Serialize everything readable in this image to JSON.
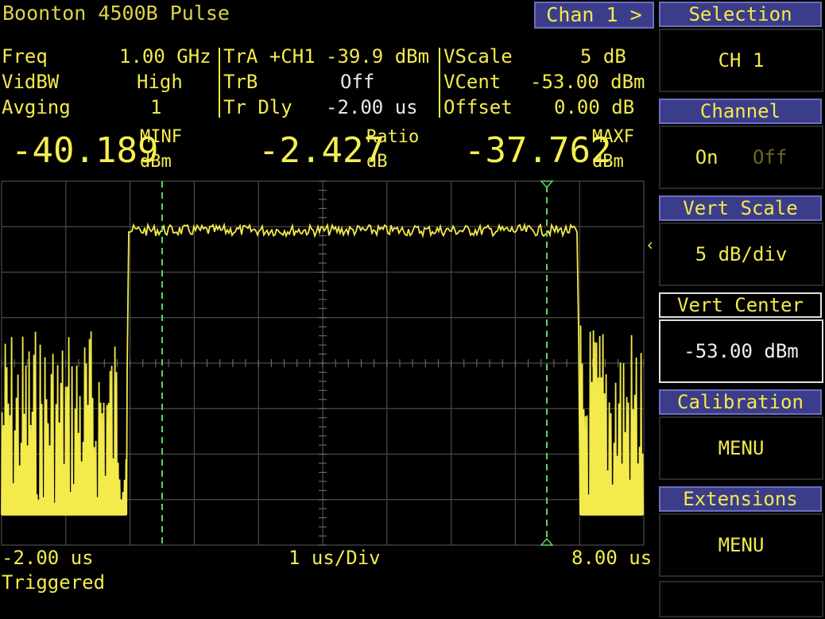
{
  "header": {
    "title": "Boonton 4500B Pulse",
    "chan_button": "Chan 1 >"
  },
  "params": {
    "col1": [
      {
        "label": "Freq",
        "value": "1.00 GHz"
      },
      {
        "label": "VidBW",
        "value": "High"
      },
      {
        "label": "Avging",
        "value": "1"
      }
    ],
    "col2": [
      {
        "label": "TrA +CH1",
        "value": "-39.9 dBm"
      },
      {
        "label": "TrB",
        "value": "Off"
      },
      {
        "label": "Tr Dly",
        "value": "-2.00 us"
      }
    ],
    "col3": [
      {
        "label": "VScale",
        "value": "5 dB"
      },
      {
        "label": "VCent",
        "value": "-53.00 dBm"
      },
      {
        "label": "Offset",
        "value": "0.00 dB"
      }
    ]
  },
  "readouts": [
    {
      "value": "-40.189",
      "label": "MINF",
      "unit": "dBm"
    },
    {
      "value": "-2.427",
      "label": "Ratio",
      "unit": "dB"
    },
    {
      "value": "-37.762",
      "label": "MAXF",
      "unit": "dBm"
    }
  ],
  "bottom": {
    "left_time": "-2.00 us",
    "timebase": "1 us/Div",
    "right_time": "8.00 us",
    "status": "Triggered"
  },
  "menu": {
    "selection_title": "Selection",
    "selection_value": "CH 1",
    "channel_title": "Channel",
    "channel_on": "On",
    "channel_off": "Off",
    "vscale_title": "Vert Scale",
    "vscale_value": "5 dB/div",
    "vcenter_title": "Vert Center",
    "vcenter_value": "-53.00 dBm",
    "calib_title": "Calibration",
    "calib_value": "MENU",
    "ext_title": "Extensions",
    "ext_value": "MENU"
  },
  "colors": {
    "trace": "#f3ea4c",
    "marker": "#5ed35e",
    "grid": "#4a4a4a",
    "menu_title_bg": "#3b3d8a"
  }
}
